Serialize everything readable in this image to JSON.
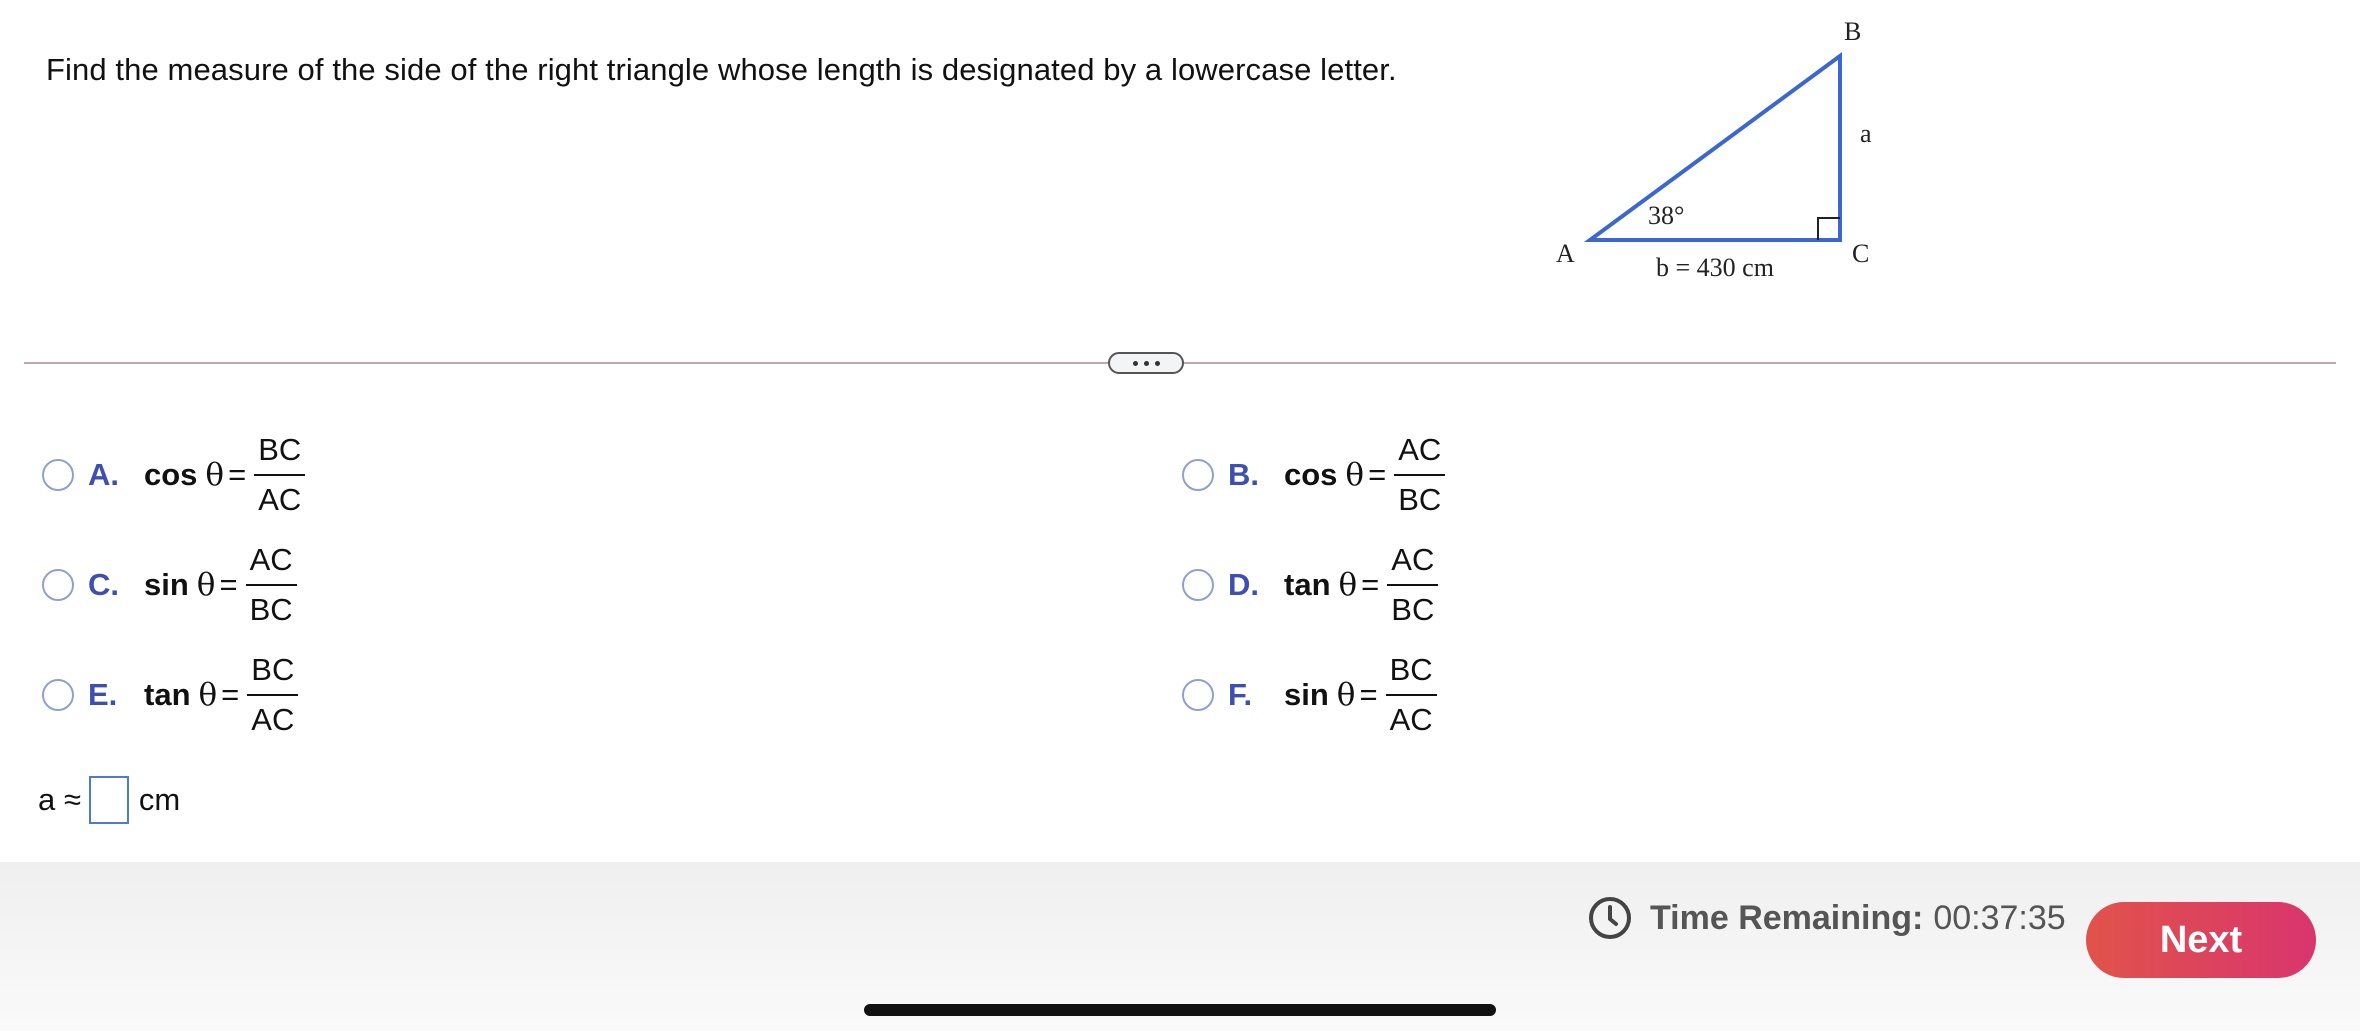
{
  "question": {
    "text": "Find the measure of the side of the right triangle whose length is designated by a lowercase letter."
  },
  "figure": {
    "vertex_a": "A",
    "vertex_b": "B",
    "vertex_c": "C",
    "side_a_label": "a",
    "side_b_label": "b = 430 cm",
    "angle_label": "38°",
    "line_color": "#3b68d0"
  },
  "divider": {
    "expand_icon": "ellipsis-icon"
  },
  "options": [
    {
      "letter": "A.",
      "func": "cos",
      "theta": "θ",
      "eq": "=",
      "num": "BC",
      "den": "AC"
    },
    {
      "letter": "B.",
      "func": "cos",
      "theta": "θ",
      "eq": "=",
      "num": "AC",
      "den": "BC"
    },
    {
      "letter": "C.",
      "func": "sin",
      "theta": "θ",
      "eq": "=",
      "num": "AC",
      "den": "BC"
    },
    {
      "letter": "D.",
      "func": "tan",
      "theta": "θ",
      "eq": "=",
      "num": "AC",
      "den": "BC"
    },
    {
      "letter": "E.",
      "func": "tan",
      "theta": "θ",
      "eq": "=",
      "num": "BC",
      "den": "AC"
    },
    {
      "letter": "F.",
      "func": "sin",
      "theta": "θ",
      "eq": "=",
      "num": "BC",
      "den": "AC"
    }
  ],
  "answer": {
    "prefix": "a ≈",
    "value": "",
    "unit": "cm"
  },
  "footer": {
    "timer_icon": "clock-icon",
    "timer_label": "Time Remaining:",
    "timer_value": "00:37:35",
    "next_label": "Next"
  },
  "colors": {
    "accent": "#3d4fb0",
    "next_button": "#dd4660"
  }
}
